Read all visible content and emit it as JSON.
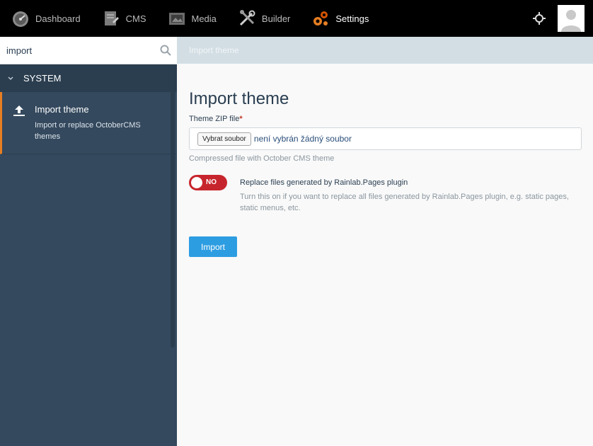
{
  "nav": {
    "items": [
      {
        "label": "Dashboard",
        "icon": "dashboard-gauge-icon"
      },
      {
        "label": "CMS",
        "icon": "cms-icon"
      },
      {
        "label": "Media",
        "icon": "media-icon"
      },
      {
        "label": "Builder",
        "icon": "builder-tools-icon"
      },
      {
        "label": "Settings",
        "icon": "settings-gears-icon",
        "active": true
      }
    ],
    "accent_color": "#e67e22"
  },
  "sidebar": {
    "search_value": "import",
    "section_label": "SYSTEM",
    "entry": {
      "title": "Import theme",
      "description": "Import or replace OctoberCMS themes",
      "icon": "upload-icon"
    }
  },
  "breadcrumb": "Import theme",
  "form": {
    "title": "Import theme",
    "file_label": "Theme ZIP file",
    "required_marker": "*",
    "file_button": "Vybrat soubor",
    "file_status": "není vybrán žádný soubor",
    "file_help": "Compressed file with October CMS theme",
    "switch_state": "NO",
    "switch_label": "Replace files generated by Rainlab.Pages plugin",
    "switch_desc": "Turn this on if you want to replace all files generated by Rainlab.Pages plugin, e.g. static pages, static menus, etc.",
    "submit_label": "Import",
    "switch_color": "#c7252d",
    "button_color": "#2d9de2"
  }
}
